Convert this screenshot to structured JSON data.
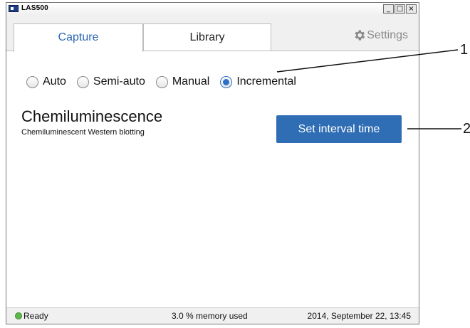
{
  "window": {
    "title": "LAS500",
    "controls": [
      "_",
      "□",
      "×"
    ]
  },
  "tabs": [
    {
      "label": "Capture",
      "active": true
    },
    {
      "label": "Library",
      "active": false
    }
  ],
  "settings": {
    "label": "Settings",
    "icon": "gear-icon"
  },
  "modes": {
    "options": [
      {
        "label": "Auto",
        "selected": false
      },
      {
        "label": "Semi-auto",
        "selected": false
      },
      {
        "label": "Manual",
        "selected": false
      },
      {
        "label": "Incremental",
        "selected": true
      }
    ]
  },
  "method": {
    "title": "Chemiluminescence",
    "subtitle": "Chemiluminescent Western blotting"
  },
  "actions": {
    "set_interval_label": "Set interval time"
  },
  "status": {
    "state": "Ready",
    "memory": "3.0 % memory used",
    "datetime": "2014, September 22, 13:45"
  },
  "callouts": [
    "1",
    "2"
  ],
  "colors": {
    "accent": "#2f6db5",
    "active_tab_text": "#2b67b4",
    "status_ok": "#5bb84a"
  }
}
